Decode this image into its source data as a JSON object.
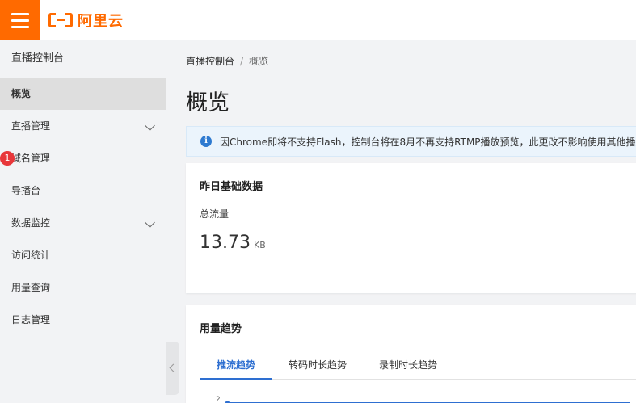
{
  "brand": {
    "logo_text": "阿里云",
    "accent": "#ff6a00"
  },
  "sidebar": {
    "title": "直播控制台",
    "items": [
      {
        "label": "概览",
        "active": true
      },
      {
        "label": "直播管理",
        "expandable": true
      },
      {
        "label": "域名管理",
        "badge": "1"
      },
      {
        "label": "导播台"
      },
      {
        "label": "数据监控",
        "expandable": true
      },
      {
        "label": "访问统计"
      },
      {
        "label": "用量查询"
      },
      {
        "label": "日志管理"
      }
    ]
  },
  "breadcrumb": {
    "root": "直播控制台",
    "separator": "/",
    "current": "概览"
  },
  "page_title": "概览",
  "notice": {
    "text": "因Chrome即将不支持Flash，控制台将在8月不再支持RTMP播放预览，此更改不影响使用其他播放器"
  },
  "yesterday_card": {
    "title": "昨日基础数据",
    "metric_label": "总流量",
    "metric_value": "13.73",
    "metric_unit": "KB"
  },
  "usage_card": {
    "title": "用量趋势",
    "tabs": [
      {
        "label": "推流趋势",
        "active": true
      },
      {
        "label": "转码时长趋势"
      },
      {
        "label": "录制时长趋势"
      }
    ],
    "chart_tick": "2"
  },
  "colors": {
    "link_blue": "#2e6fd1",
    "badge_red": "#e8373a",
    "notice_bg": "#ebf4fc"
  }
}
